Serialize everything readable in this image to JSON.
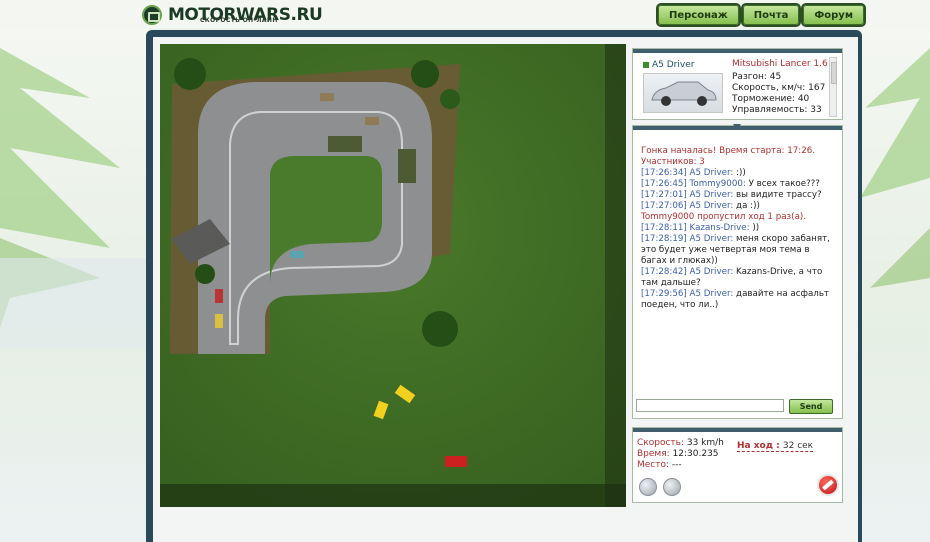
{
  "header": {
    "logo_text": "MOTORWARS.RU",
    "logo_sub": "СКОРОСТЬ ОН-ЛАЙН",
    "nav": [
      "Персонаж",
      "Почта",
      "Форум"
    ]
  },
  "driver": {
    "name": "A5 Driver",
    "car": "Mitsubishi Lancer 1.6",
    "stats": [
      "Разгон: 45",
      "Скорость, км/ч: 167",
      "Торможение: 40",
      "Управляемость: 33"
    ]
  },
  "chat": {
    "lines": [
      {
        "type": "sys",
        "text": "Гонка началась! Время старта: 17:26."
      },
      {
        "type": "sys",
        "text": "Участников: 3"
      },
      {
        "type": "msg",
        "ts": "[17:26:34] A5 Driver:",
        "text": " :))"
      },
      {
        "type": "msg",
        "ts": "[17:26:45] Tommy9000:",
        "text": " У всех такое???"
      },
      {
        "type": "msg",
        "ts": "[17:27:01] A5 Driver:",
        "text": " вы видите трассу?"
      },
      {
        "type": "msg",
        "ts": "[17:27:06] A5 Driver:",
        "text": " да :))"
      },
      {
        "type": "sys",
        "text": "Tommy9000 пропустил ход 1 раз(а)."
      },
      {
        "type": "msg",
        "ts": "[17:28:11] Kazans-Drive:",
        "text": " ))"
      },
      {
        "type": "msg",
        "ts": "[17:28:19] A5 Driver:",
        "text": " меня скоро забанят, это будет уже четвертая моя тема в багах и глюках))"
      },
      {
        "type": "msg",
        "ts": "[17:28:42] A5 Driver:",
        "text": " Kazans-Drive, а что там дальше?"
      },
      {
        "type": "msg",
        "ts": "[17:29:56] A5 Driver:",
        "text": " давайте на асфальт поеден, что ли..)"
      }
    ],
    "send_label": "Send"
  },
  "status": {
    "speed_label": "Скорость:",
    "speed_value": "33 km/h",
    "time_label": "Время:",
    "time_value": "12:30.235",
    "place_label": "Место:",
    "place_value": "---",
    "turn_label": "На ход :",
    "turn_value": "32 сек"
  },
  "colors": {
    "accent_green": "#86bf4f",
    "label_red": "#b03030",
    "timestamp_blue": "#3b5fa8",
    "frame_dark": "#2a4a5c"
  }
}
